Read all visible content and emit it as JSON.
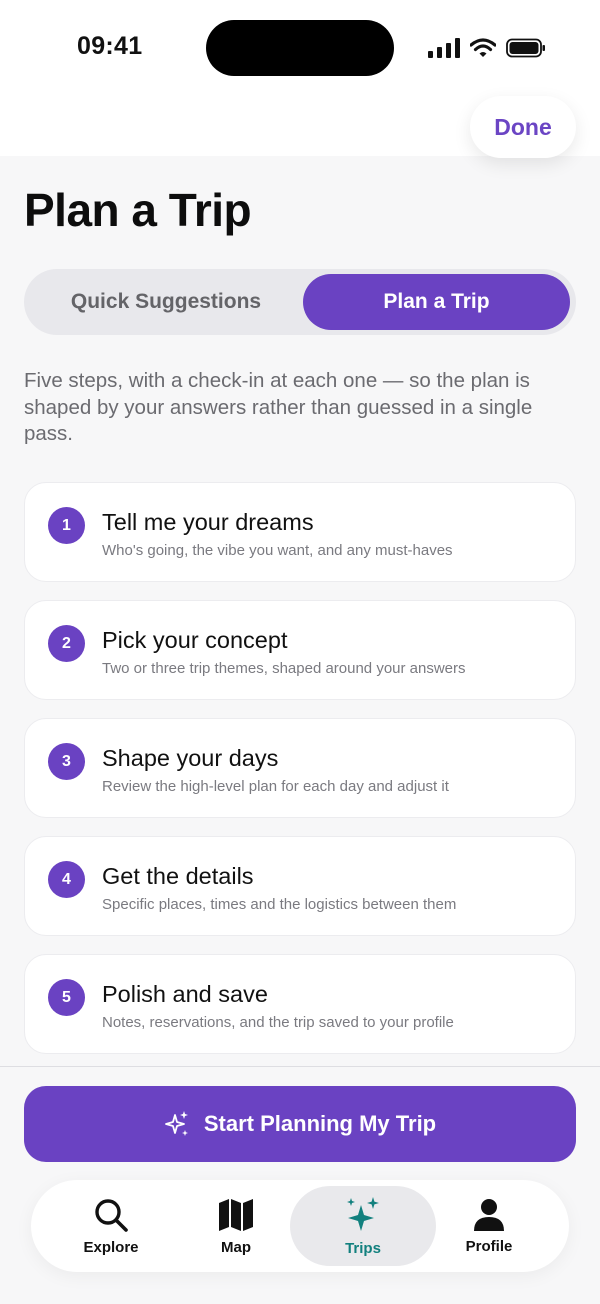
{
  "status_bar": {
    "time": "09:41"
  },
  "header": {
    "done_label": "Done",
    "title": "Plan a Trip"
  },
  "segmented": {
    "options": [
      "Quick Suggestions",
      "Plan a Trip"
    ],
    "selected": "Plan a Trip"
  },
  "intro": "Five steps, with a check-in at each one — so the plan is shaped by your answers rather than guessed in a single pass.",
  "steps": [
    {
      "number": "1",
      "title": "Tell me your dreams",
      "description": "Who's going, the vibe you want, and any must-haves"
    },
    {
      "number": "2",
      "title": "Pick your concept",
      "description": "Two or three trip themes, shaped around your answers"
    },
    {
      "number": "3",
      "title": "Shape your days",
      "description": "Review the high-level plan for each day and adjust it"
    },
    {
      "number": "4",
      "title": "Get the details",
      "description": "Specific places, times and the logistics between them"
    },
    {
      "number": "5",
      "title": "Polish and save",
      "description": "Notes, reservations, and the trip saved to your profile"
    }
  ],
  "cta": {
    "label": "Start Planning My Trip",
    "icon": "sparkles-icon"
  },
  "tab_bar": {
    "tabs": [
      {
        "label": "Explore",
        "icon": "search-icon"
      },
      {
        "label": "Map",
        "icon": "map-icon"
      },
      {
        "label": "Trips",
        "icon": "sparkles-icon",
        "active": true
      },
      {
        "label": "Profile",
        "icon": "person-icon"
      }
    ]
  },
  "colors": {
    "accent": "#6a42c2",
    "active_tab": "#12807e",
    "background": "#f7f7f8"
  }
}
